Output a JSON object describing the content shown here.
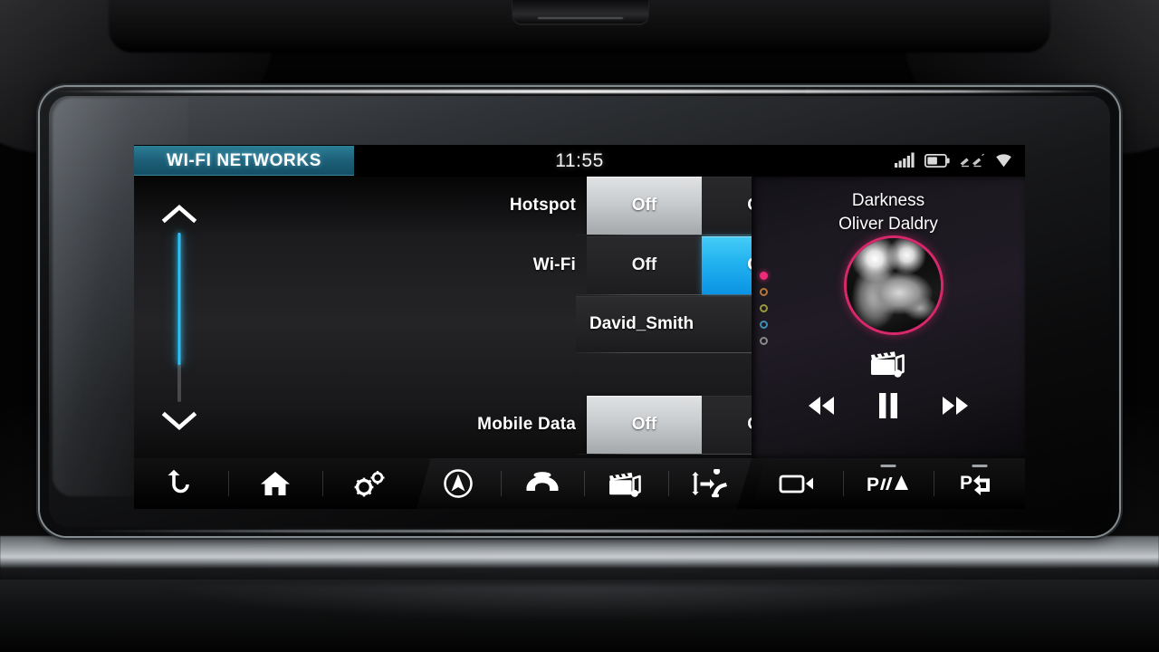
{
  "device": "jaguar-land-rover-infotainment-touchscreen",
  "screen": {
    "status_bar": {
      "page_tab_label": "WI-FI NETWORKS",
      "clock": "11:55",
      "icons": [
        {
          "name": "cellular-signal-icon",
          "bars": 5,
          "active_bars": 5
        },
        {
          "name": "battery-icon",
          "level_percent": 55
        },
        {
          "name": "bluetooth-devices-icon"
        },
        {
          "name": "wifi-icon"
        }
      ]
    },
    "scrollbar": {
      "up_arrow": "scroll-up",
      "down_arrow": "scroll-down",
      "fill_percent": 78,
      "fill_color": "#3fd4fb"
    },
    "settings_rows": [
      {
        "key": "hotspot",
        "label": "Hotspot",
        "type": "toggle",
        "options": [
          "Off",
          "On"
        ],
        "selected": "Off",
        "selected_style": "gray"
      },
      {
        "key": "wifi",
        "label": "Wi-Fi",
        "type": "toggle",
        "options": [
          "Off",
          "On"
        ],
        "selected": "On",
        "selected_style": "blue"
      },
      {
        "key": "network",
        "label": "",
        "type": "list-item",
        "value": "David_Smith",
        "chevron": "chevron-right-icon"
      },
      {
        "key": "mobile_data",
        "label": "Mobile Data",
        "type": "toggle",
        "options": [
          "Off",
          "On"
        ],
        "selected": "Off",
        "selected_style": "gray"
      }
    ],
    "media_panel": {
      "track_title": "Darkness",
      "artist": "Oliver Daldry",
      "album_art": "circular-album-art",
      "source_icon": "media-clapperboard-note-icon",
      "source_dots": [
        {
          "color": "#ef2a78",
          "active": true
        },
        {
          "color": "#b5763a",
          "active": false
        },
        {
          "color": "#9a9a3c",
          "active": false
        },
        {
          "color": "#3d8fb5",
          "active": false
        },
        {
          "color": "#8a8a8a",
          "active": false
        }
      ],
      "controls": [
        {
          "name": "rewind-button",
          "glyph": "rewind"
        },
        {
          "name": "pause-button",
          "glyph": "pause"
        },
        {
          "name": "fast-forward-button",
          "glyph": "fast-forward"
        }
      ]
    },
    "nav_bar": {
      "left_group": [
        {
          "name": "back-button",
          "icon": "back-arrow-icon"
        },
        {
          "name": "home-button",
          "icon": "home-icon"
        },
        {
          "name": "settings-button",
          "icon": "settings-gears-icon"
        }
      ],
      "middle_group": [
        {
          "name": "navigation-button",
          "icon": "navigation-compass-icon"
        },
        {
          "name": "phone-button",
          "icon": "telephone-icon"
        },
        {
          "name": "media-button",
          "icon": "media-clapperboard-note-icon"
        },
        {
          "name": "climate-seat-button",
          "icon": "climate-seat-icon"
        }
      ],
      "right_group": [
        {
          "name": "camera-button",
          "icon": "camera-icon",
          "indicator": false
        },
        {
          "name": "park-assist-sensors-button",
          "icon": "park-sensor-icon",
          "indicator": true
        },
        {
          "name": "park-assist-maneuver-button",
          "icon": "park-maneuver-icon",
          "indicator": true
        }
      ]
    }
  },
  "theme": {
    "tab_teal": "#1d6078",
    "accent_blue": "#24b4f0",
    "scroll_cyan": "#3fd4fb",
    "album_ring_pink": "#d6286b",
    "selected_gray": "#c9ccce",
    "screen_black": "#000000"
  }
}
